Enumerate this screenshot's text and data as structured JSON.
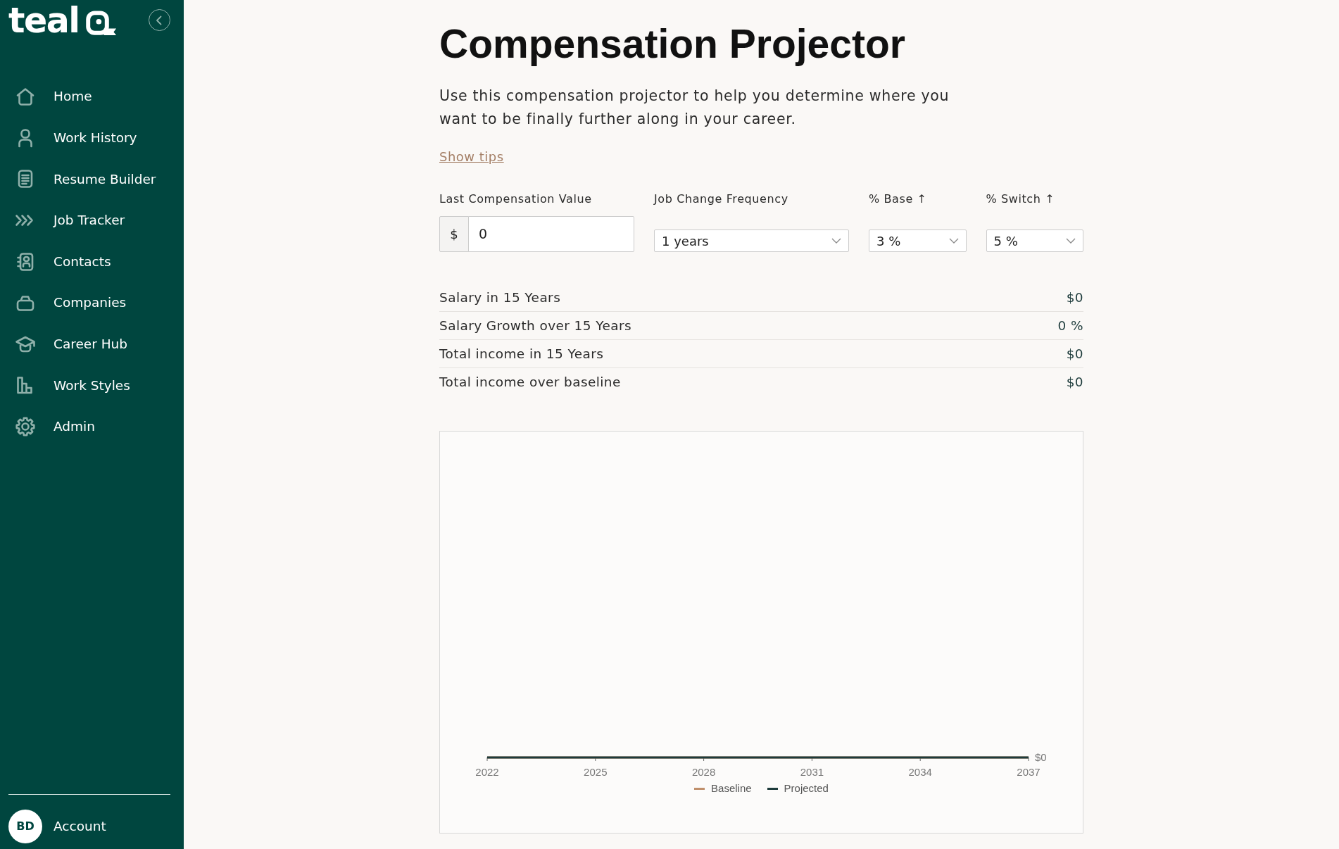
{
  "sidebar": {
    "brand": {
      "name": "teal"
    },
    "items": [
      {
        "label": "Home",
        "selected": false
      },
      {
        "label": "Work History",
        "selected": false
      },
      {
        "label": "Resume Builder",
        "selected": false
      },
      {
        "label": "Job Tracker",
        "selected": false
      },
      {
        "label": "Contacts",
        "selected": false
      },
      {
        "label": "Companies",
        "selected": false
      },
      {
        "label": "Career Hub",
        "selected": false
      },
      {
        "label": "Work Styles",
        "selected": false
      },
      {
        "label": "Admin",
        "selected": false
      }
    ],
    "account": {
      "initials": "BD",
      "label": "Account"
    }
  },
  "page": {
    "title": "Compensation Projector",
    "description": "Use this compensation projector to help you determine where you want to be finally further along in your career.",
    "tips_link": "Show tips"
  },
  "form": {
    "fields": [
      {
        "kind": "currency",
        "label": "Last Compensation Value",
        "prefix": "$",
        "value": "0"
      },
      {
        "kind": "select",
        "label": "Job Change Frequency",
        "value": "1 years"
      },
      {
        "kind": "select",
        "label": "% Base ↑",
        "value": "3 %"
      },
      {
        "kind": "select",
        "label": "% Switch ↑",
        "value": "5 %"
      }
    ]
  },
  "summary": [
    {
      "label": "Salary in 15 Years",
      "value": "$0"
    },
    {
      "label": "Salary Growth over 15 Years",
      "value": "0 %"
    },
    {
      "label": "Total income in 15 Years",
      "value": "$0"
    },
    {
      "label": "Total income over baseline",
      "value": "$0"
    }
  ],
  "chart": {
    "axis_labels": [
      "2022",
      "2025",
      "2028",
      "2031",
      "2034",
      "2037"
    ],
    "end_value_label": "$0",
    "legend": [
      {
        "label": "Baseline",
        "color": "#c0906c"
      },
      {
        "label": "Projected",
        "color": "#1d3b3b"
      }
    ]
  }
}
